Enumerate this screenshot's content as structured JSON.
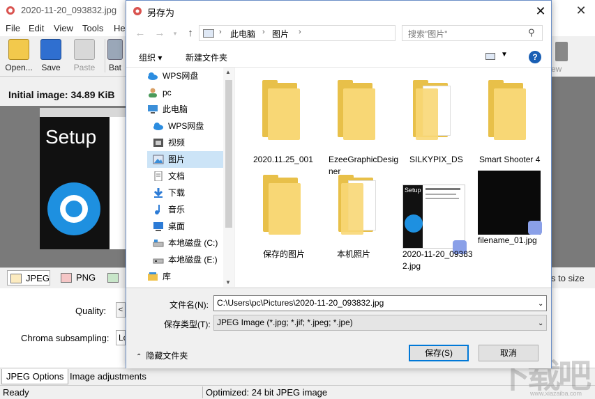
{
  "bg_app": {
    "title": "2020-11-20_093832.jpg",
    "menus": [
      "File",
      "Edit",
      "View",
      "Tools",
      "He"
    ],
    "toolbar": [
      "Open...",
      "Save",
      "Paste",
      "Bat"
    ],
    "right_tool_label": "ew",
    "initial_image": "Initial image:  34.89 KiB",
    "preview_setup_text": "Setup",
    "format_tabs": [
      "JPEG",
      "PNG"
    ],
    "size_to": "s to size",
    "quality_label": "Quality:",
    "chroma_label": "Chroma subsampling:",
    "chroma_value": "Lo",
    "bottom_tabs": [
      "JPEG Options",
      "Image adjustments"
    ],
    "status_ready": "Ready",
    "status_optimized": "Optimized: 24 bit JPEG image"
  },
  "dialog": {
    "title": "另存为",
    "address": {
      "pc": "此电脑",
      "folder": "图片"
    },
    "search_placeholder": "搜索\"图片\"",
    "organize": "组织 ▾",
    "new_folder": "新建文件夹",
    "nav_items": [
      {
        "label": "WPS网盘",
        "icon": "cloud-icon"
      },
      {
        "label": "pc",
        "icon": "user-icon"
      },
      {
        "label": "此电脑",
        "icon": "computer-icon"
      },
      {
        "label": "WPS网盘",
        "icon": "cloud-icon"
      },
      {
        "label": "视频",
        "icon": "video-icon"
      },
      {
        "label": "图片",
        "icon": "pictures-icon"
      },
      {
        "label": "文档",
        "icon": "documents-icon"
      },
      {
        "label": "下载",
        "icon": "download-icon"
      },
      {
        "label": "音乐",
        "icon": "music-icon"
      },
      {
        "label": "桌面",
        "icon": "desktop-icon"
      },
      {
        "label": "本地磁盘 (C:)",
        "icon": "drive-icon"
      },
      {
        "label": "本地磁盘 (E:)",
        "icon": "drive-icon"
      },
      {
        "label": "库",
        "icon": "library-icon"
      }
    ],
    "files": [
      {
        "name": "2020.11.25_001",
        "kind": "folder"
      },
      {
        "name": "EzeeGraphicDesigner",
        "kind": "folder"
      },
      {
        "name": "SILKYPIX_DS",
        "kind": "folder-paper"
      },
      {
        "name": "Smart Shooter 4",
        "kind": "folder"
      },
      {
        "name": "保存的图片",
        "kind": "folder"
      },
      {
        "name": "本机照片",
        "kind": "folder-paper"
      },
      {
        "name": "2020-11-20_093832.jpg",
        "kind": "image-setup"
      },
      {
        "name": "filename_01.jpg",
        "kind": "image-dark"
      }
    ],
    "filename_label": "文件名(N):",
    "filename_value": "C:\\Users\\pc\\Pictures\\2020-11-20_093832.jpg",
    "filetype_label": "保存类型(T):",
    "filetype_value": "JPEG Image (*.jpg; *.jif; *.jpeg; *.jpe)",
    "hide_folders": "隐藏文件夹",
    "save": "保存(S)",
    "cancel": "取消"
  },
  "watermark": "下载吧",
  "watermark_url": "www.xiazaiba.com",
  "colors": {
    "accent": "#0078d7",
    "folder": "#f8d775",
    "selection": "#cce4f7"
  }
}
